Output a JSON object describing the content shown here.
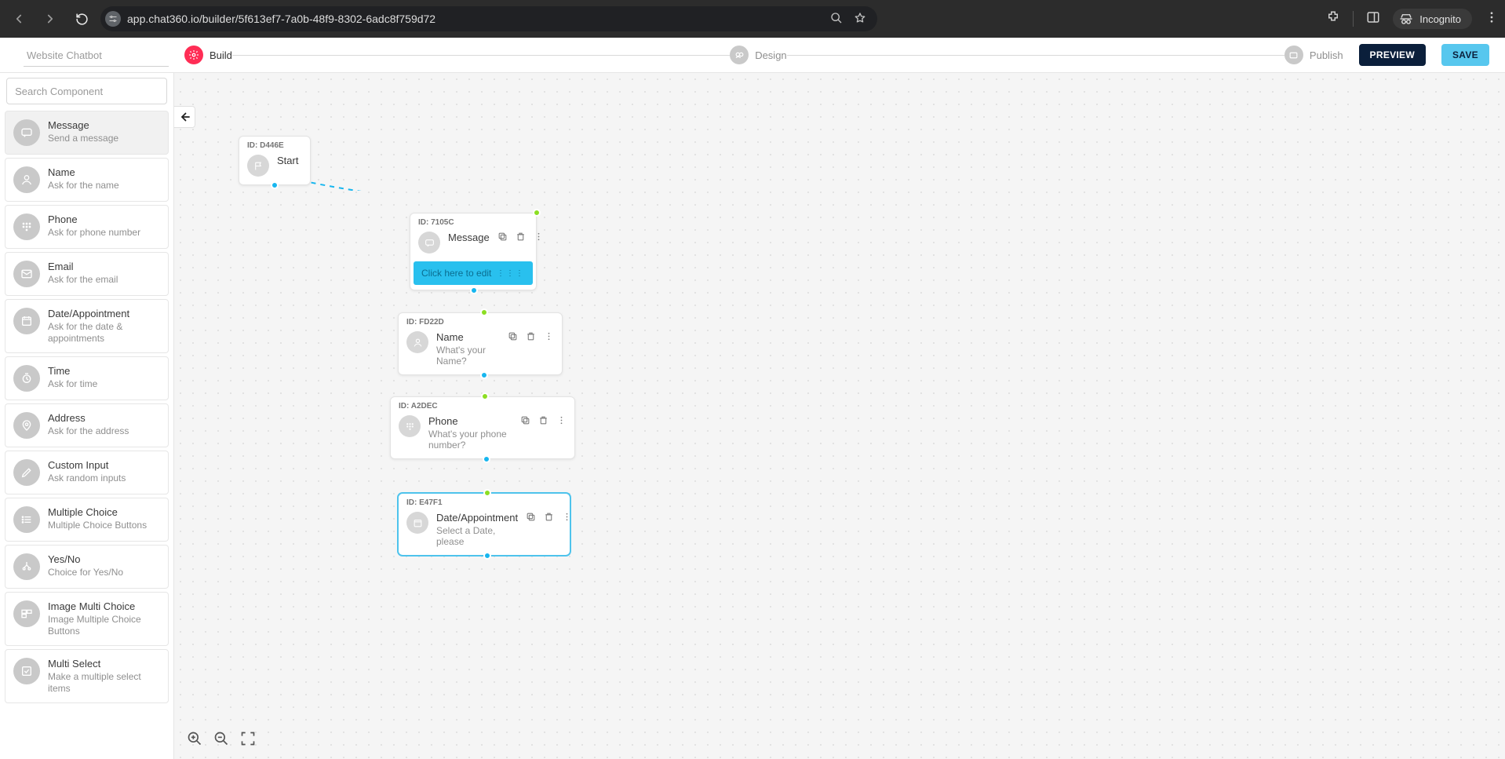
{
  "browser": {
    "url": "app.chat360.io/builder/5f613ef7-7a0b-48f9-8302-6adc8f759d72",
    "incognito_label": "Incognito"
  },
  "header": {
    "project_name": "Website Chatbot",
    "steps": {
      "build": "Build",
      "design": "Design",
      "publish": "Publish"
    },
    "preview_button": "PREVIEW",
    "save_button": "SAVE"
  },
  "sidebar": {
    "search_placeholder": "Search Component",
    "components": [
      {
        "title": "Message",
        "subtitle": "Send a message"
      },
      {
        "title": "Name",
        "subtitle": "Ask for the name"
      },
      {
        "title": "Phone",
        "subtitle": "Ask for phone number"
      },
      {
        "title": "Email",
        "subtitle": "Ask for the email"
      },
      {
        "title": "Date/Appointment",
        "subtitle": "Ask for the date & appointments"
      },
      {
        "title": "Time",
        "subtitle": "Ask for time"
      },
      {
        "title": "Address",
        "subtitle": "Ask for the address"
      },
      {
        "title": "Custom Input",
        "subtitle": "Ask random inputs"
      },
      {
        "title": "Multiple Choice",
        "subtitle": "Multiple Choice Buttons"
      },
      {
        "title": "Yes/No",
        "subtitle": "Choice for Yes/No"
      },
      {
        "title": "Image Multi Choice",
        "subtitle": "Image Multiple Choice Buttons"
      },
      {
        "title": "Multi Select",
        "subtitle": "Make a multiple select items"
      }
    ]
  },
  "flow": {
    "nodes": {
      "start": {
        "id": "ID: D446E",
        "title": "Start"
      },
      "message": {
        "id": "ID: 7105C",
        "title": "Message",
        "edit_text": "Click here to edit"
      },
      "name": {
        "id": "ID: FD22D",
        "title": "Name",
        "subtitle": "What's your Name?"
      },
      "phone": {
        "id": "ID: A2DEC",
        "title": "Phone",
        "subtitle": "What's your phone number?"
      },
      "date": {
        "id": "ID: E47F1",
        "title": "Date/Appointment",
        "subtitle": "Select a Date, please"
      }
    }
  }
}
